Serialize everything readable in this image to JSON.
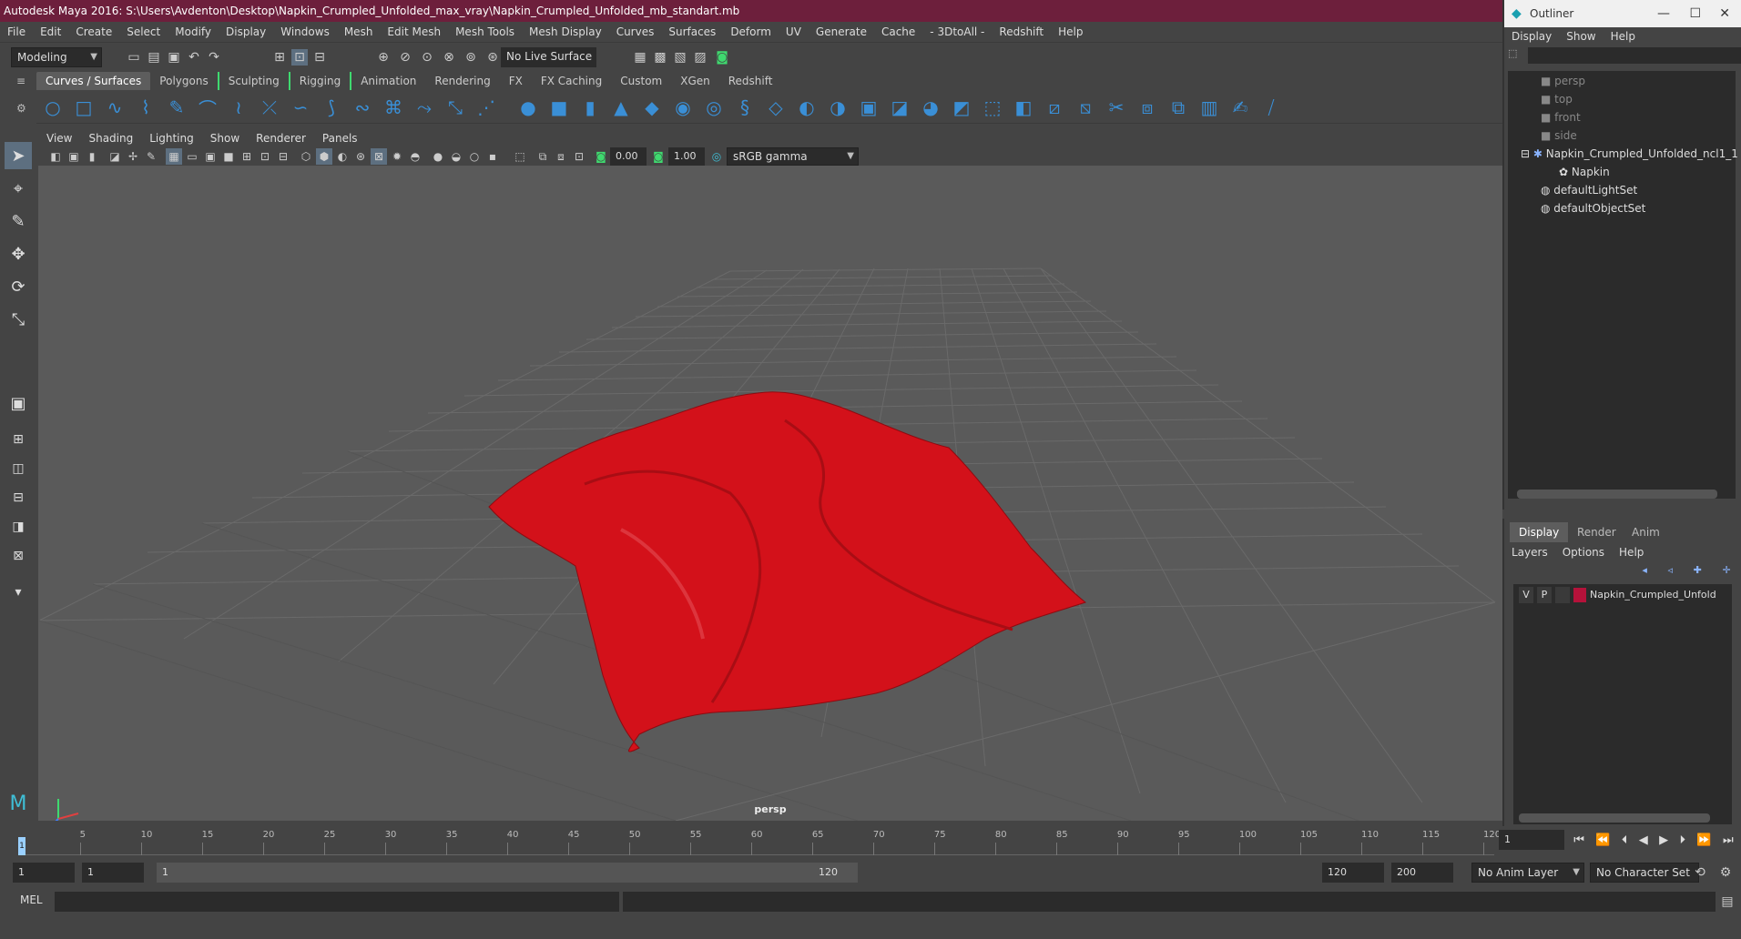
{
  "title": "Autodesk Maya 2016: S:\\Users\\Avdenton\\Desktop\\Napkin_Crumpled_Unfolded_max_vray\\Napkin_Crumpled_Unfolded_mb_standart.mb",
  "menu": [
    "File",
    "Edit",
    "Create",
    "Select",
    "Modify",
    "Display",
    "Windows",
    "Mesh",
    "Edit Mesh",
    "Mesh Tools",
    "Mesh Display",
    "Curves",
    "Surfaces",
    "Deform",
    "UV",
    "Generate",
    "Cache",
    "- 3DtoAll -",
    "Redshift",
    "Help"
  ],
  "status_line": {
    "mode": "Modeling",
    "live_surface": "No Live Surface"
  },
  "shelf_tabs": [
    "Curves / Surfaces",
    "Polygons",
    "Sculpting",
    "Rigging",
    "Animation",
    "Rendering",
    "FX",
    "FX Caching",
    "Custom",
    "XGen",
    "Redshift"
  ],
  "active_shelf_tab": "Curves / Surfaces",
  "panel_menu": [
    "View",
    "Shading",
    "Lighting",
    "Show",
    "Renderer",
    "Panels"
  ],
  "panel_toolbar": {
    "exposure": "0.00",
    "gamma": "1.00",
    "color_space": "sRGB gamma"
  },
  "viewport": {
    "camera_label": "persp",
    "object_color": "#d3111a"
  },
  "timeline": {
    "ticks": [
      "5",
      "10",
      "15",
      "20",
      "25",
      "30",
      "35",
      "40",
      "45",
      "50",
      "55",
      "60",
      "65",
      "70",
      "75",
      "80",
      "85",
      "90",
      "95",
      "100",
      "105",
      "110",
      "115",
      "120"
    ],
    "current_frame": "1",
    "start_marker": "1"
  },
  "range": {
    "start": "1",
    "playback_start": "1",
    "slider_start": "1",
    "slider_end": "120",
    "playback_end": "120",
    "end": "200",
    "anim_layer": "No Anim Layer",
    "character_set": "No Character Set"
  },
  "command_line": {
    "label": "MEL"
  },
  "outliner": {
    "title": "Outliner",
    "menu": [
      "Display",
      "Show",
      "Help"
    ],
    "items": [
      "persp",
      "top",
      "front",
      "side",
      "Napkin_Crumpled_Unfolded_ncl1_1",
      "Napkin",
      "defaultLightSet",
      "defaultObjectSet"
    ]
  },
  "layers": {
    "tabs": [
      "Display",
      "Render",
      "Anim"
    ],
    "active_tab": "Display",
    "menu": [
      "Layers",
      "Options",
      "Help"
    ],
    "layer": {
      "v": "V",
      "p": "P",
      "name": "Napkin_Crumpled_Unfold",
      "color": "#b5123a"
    }
  }
}
